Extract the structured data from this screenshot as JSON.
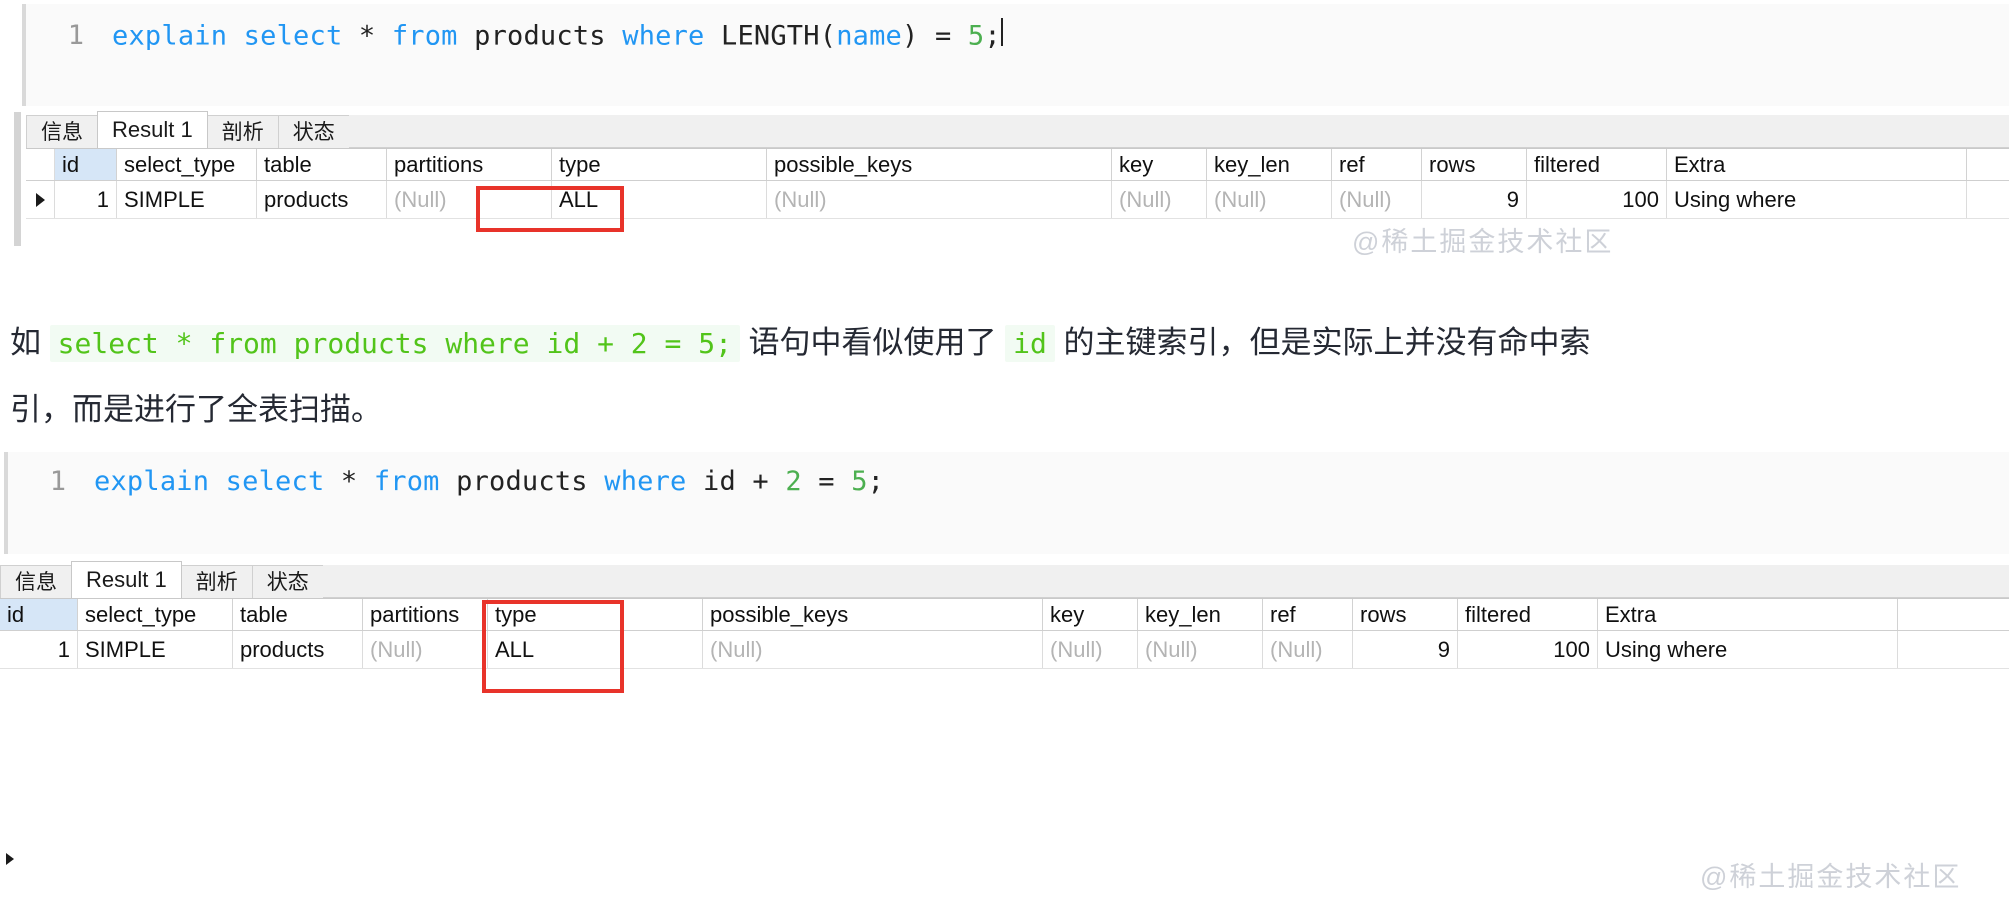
{
  "blocks": {
    "code1": {
      "line_number": "1",
      "tokens": [
        {
          "t": "explain",
          "c": "kw"
        },
        {
          "t": " ",
          "c": "pl"
        },
        {
          "t": "select",
          "c": "kw"
        },
        {
          "t": " ",
          "c": "pl"
        },
        {
          "t": "*",
          "c": "pl"
        },
        {
          "t": " ",
          "c": "pl"
        },
        {
          "t": "from",
          "c": "kw"
        },
        {
          "t": " ",
          "c": "pl"
        },
        {
          "t": "products",
          "c": "pl"
        },
        {
          "t": " ",
          "c": "pl"
        },
        {
          "t": "where",
          "c": "kw"
        },
        {
          "t": " ",
          "c": "pl"
        },
        {
          "t": "LENGTH",
          "c": "pl"
        },
        {
          "t": "(",
          "c": "pl"
        },
        {
          "t": "name",
          "c": "kw"
        },
        {
          "t": ")",
          "c": "pl"
        },
        {
          "t": " = ",
          "c": "pl"
        },
        {
          "t": "5",
          "c": "num"
        },
        {
          "t": ";",
          "c": "pl"
        }
      ],
      "plain": "explain select * from products where LENGTH(name) = 5;"
    },
    "code2": {
      "line_number": "1",
      "tokens": [
        {
          "t": "explain",
          "c": "kw"
        },
        {
          "t": " ",
          "c": "pl"
        },
        {
          "t": "select",
          "c": "kw"
        },
        {
          "t": " ",
          "c": "pl"
        },
        {
          "t": "*",
          "c": "pl"
        },
        {
          "t": " ",
          "c": "pl"
        },
        {
          "t": "from",
          "c": "kw"
        },
        {
          "t": " ",
          "c": "pl"
        },
        {
          "t": "products",
          "c": "pl"
        },
        {
          "t": " ",
          "c": "pl"
        },
        {
          "t": "where",
          "c": "kw"
        },
        {
          "t": " ",
          "c": "pl"
        },
        {
          "t": "id",
          "c": "pl"
        },
        {
          "t": " + ",
          "c": "pl"
        },
        {
          "t": "2",
          "c": "num"
        },
        {
          "t": " = ",
          "c": "pl"
        },
        {
          "t": "5",
          "c": "num"
        },
        {
          "t": ";",
          "c": "pl"
        }
      ],
      "plain": "explain select * from products where id + 2 = 5;"
    }
  },
  "result_panel": {
    "tabs": [
      {
        "label": "信息",
        "active": false
      },
      {
        "label": "Result 1",
        "active": true
      },
      {
        "label": "剖析",
        "active": false
      },
      {
        "label": "状态",
        "active": false
      }
    ],
    "columns": [
      "id",
      "select_type",
      "table",
      "partitions",
      "type",
      "possible_keys",
      "key",
      "key_len",
      "ref",
      "rows",
      "filtered",
      "Extra"
    ],
    "rows": [
      {
        "id": "1",
        "select_type": "SIMPLE",
        "table": "products",
        "partitions": "(Null)",
        "type": "ALL",
        "possible_keys": "(Null)",
        "key": "(Null)",
        "key_len": "(Null)",
        "ref": "(Null)",
        "rows": "9",
        "filtered": "100",
        "Extra": "Using where"
      }
    ],
    "highlight_column": "type",
    "watermark": "@稀土掘金技术社区"
  },
  "prose": {
    "lead": "如",
    "code_inline_1": "select * from products where id + 2 = 5;",
    "mid": "语句中看似使用了",
    "code_inline_2": "id",
    "tail": "的主键索引，但是实际上并没有命中索",
    "line2": "引，而是进行了全表扫描。"
  },
  "colors": {
    "accent_red": "#e8332a",
    "code_keyword": "#2196f3",
    "code_number": "#4caf50",
    "inline_code_text": "#52c41a",
    "inline_code_bg": "#f2fbf3",
    "header_highlight": "#d6e6f7",
    "null_text": "#b4b4b4",
    "watermark": "#c9cdd4"
  }
}
